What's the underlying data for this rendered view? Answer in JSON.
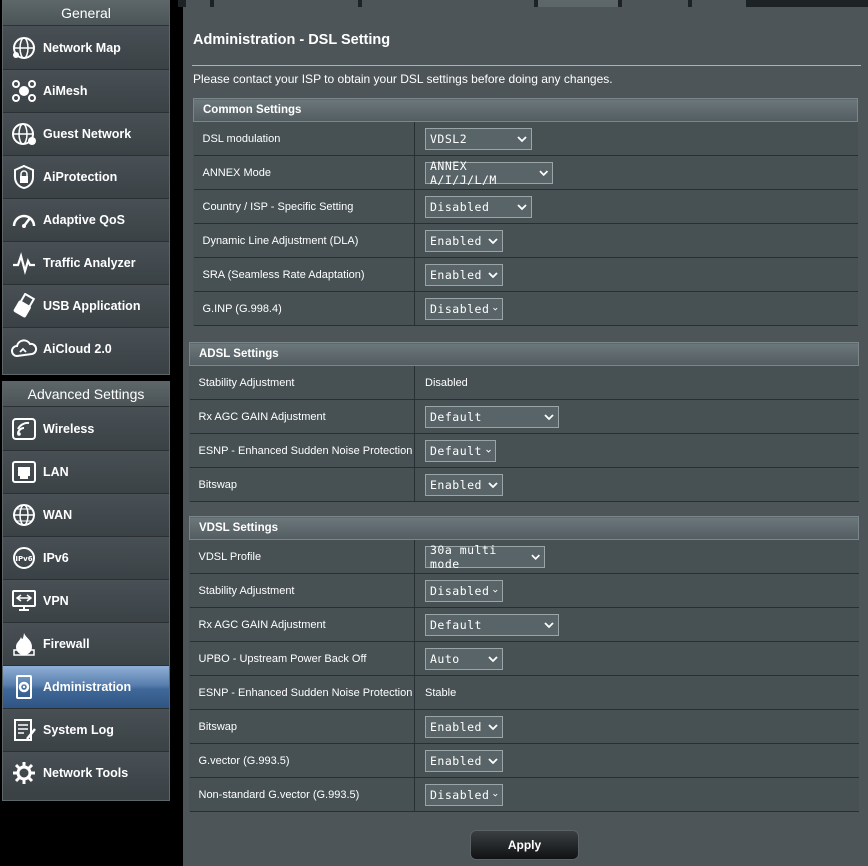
{
  "sidebar": {
    "general_title": "General",
    "general_items": [
      {
        "label": "Network Map",
        "icon": "network-map-icon"
      },
      {
        "label": "AiMesh",
        "icon": "aimesh-icon"
      },
      {
        "label": "Guest Network",
        "icon": "guest-network-icon"
      },
      {
        "label": "AiProtection",
        "icon": "aiprotection-icon"
      },
      {
        "label": "Adaptive QoS",
        "icon": "adaptive-qos-icon"
      },
      {
        "label": "Traffic Analyzer",
        "icon": "traffic-analyzer-icon"
      },
      {
        "label": "USB Application",
        "icon": "usb-application-icon"
      },
      {
        "label": "AiCloud 2.0",
        "icon": "aicloud-icon"
      }
    ],
    "advanced_title": "Advanced Settings",
    "advanced_items": [
      {
        "label": "Wireless",
        "icon": "wireless-icon"
      },
      {
        "label": "LAN",
        "icon": "lan-icon"
      },
      {
        "label": "WAN",
        "icon": "wan-icon"
      },
      {
        "label": "IPv6",
        "icon": "ipv6-icon"
      },
      {
        "label": "VPN",
        "icon": "vpn-icon"
      },
      {
        "label": "Firewall",
        "icon": "firewall-icon"
      },
      {
        "label": "Administration",
        "icon": "administration-icon",
        "active": true
      },
      {
        "label": "System Log",
        "icon": "system-log-icon"
      },
      {
        "label": "Network Tools",
        "icon": "network-tools-icon"
      }
    ]
  },
  "page": {
    "title": "Administration - DSL Setting",
    "description": "Please contact your ISP to obtain your DSL settings before doing any changes."
  },
  "common": {
    "header": "Common Settings",
    "rows": [
      {
        "label": "DSL modulation",
        "value": "VDSL2"
      },
      {
        "label": "ANNEX Mode",
        "value": "ANNEX A/I/J/L/M"
      },
      {
        "label": "Country / ISP - Specific Setting",
        "value": "Disabled"
      },
      {
        "label": "Dynamic Line Adjustment (DLA)",
        "value": "Enabled"
      },
      {
        "label": "SRA (Seamless Rate Adaptation)",
        "value": "Enabled"
      },
      {
        "label": "G.INP (G.998.4)",
        "value": "Disabled"
      }
    ]
  },
  "adsl": {
    "header": "ADSL Settings",
    "rows": [
      {
        "label": "Stability Adjustment",
        "value": "Disabled"
      },
      {
        "label": "Rx AGC GAIN Adjustment",
        "value": "Default"
      },
      {
        "label": "ESNP - Enhanced Sudden Noise Protection",
        "value": "Default"
      },
      {
        "label": "Bitswap",
        "value": "Enabled"
      }
    ]
  },
  "vdsl": {
    "header": "VDSL Settings",
    "rows": [
      {
        "label": "VDSL Profile",
        "value": "30a multi mode"
      },
      {
        "label": "Stability Adjustment",
        "value": "Disabled"
      },
      {
        "label": "Rx AGC GAIN Adjustment",
        "value": "Default"
      },
      {
        "label": "UPBO - Upstream Power Back Off",
        "value": "Auto"
      },
      {
        "label": "ESNP - Enhanced Sudden Noise Protection",
        "value": "Stable"
      },
      {
        "label": "Bitswap",
        "value": "Enabled"
      },
      {
        "label": "G.vector (G.993.5)",
        "value": "Enabled"
      },
      {
        "label": "Non-standard G.vector (G.993.5)",
        "value": "Disabled"
      }
    ]
  },
  "apply_label": "Apply",
  "colors": {
    "panel": "#4d5558",
    "row": "#475154",
    "active_menu": "#3f6898",
    "sidebar": "#3a4246"
  }
}
